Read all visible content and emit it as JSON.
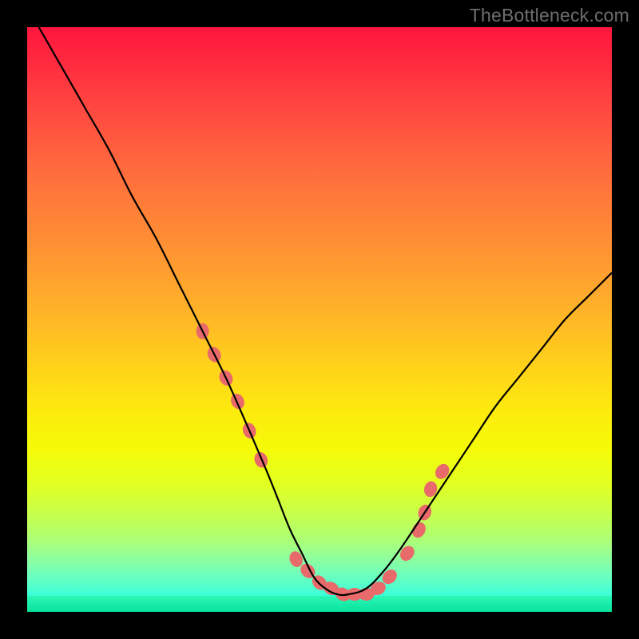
{
  "watermark": "TheBottleneck.com",
  "colors": {
    "frame": "#000000",
    "curve": "#000000",
    "marker": "#e86a6a",
    "gradient_top": "#ff163e",
    "gradient_bottom": "#15f7c4",
    "green_band": "#08e39c"
  },
  "chart_data": {
    "type": "line",
    "title": "",
    "xlabel": "",
    "ylabel": "",
    "xlim": [
      0,
      100
    ],
    "ylim": [
      0,
      100
    ],
    "grid": false,
    "legend": false,
    "series": [
      {
        "name": "bottleneck-curve",
        "x": [
          2,
          6,
          10,
          14,
          18,
          22,
          26,
          30,
          34,
          38,
          41,
          43,
          45,
          47,
          49,
          51,
          53,
          55,
          58,
          61,
          64,
          68,
          72,
          76,
          80,
          84,
          88,
          92,
          96,
          100
        ],
        "values": [
          100,
          93,
          86,
          79,
          71,
          64,
          56,
          48,
          40,
          31,
          24,
          19,
          14,
          10,
          6,
          4,
          3,
          3,
          4,
          7,
          11,
          17,
          23,
          29,
          35,
          40,
          45,
          50,
          54,
          58
        ]
      }
    ],
    "markers": {
      "name": "highlighted-points",
      "x": [
        30,
        32,
        34,
        36,
        38,
        40,
        46,
        48,
        50,
        52,
        54,
        56,
        58,
        60,
        62,
        65,
        67,
        68,
        69,
        71
      ],
      "values": [
        48,
        44,
        40,
        36,
        31,
        26,
        9,
        7,
        5,
        4,
        3,
        3,
        3,
        4,
        6,
        10,
        14,
        17,
        21,
        24
      ]
    }
  }
}
